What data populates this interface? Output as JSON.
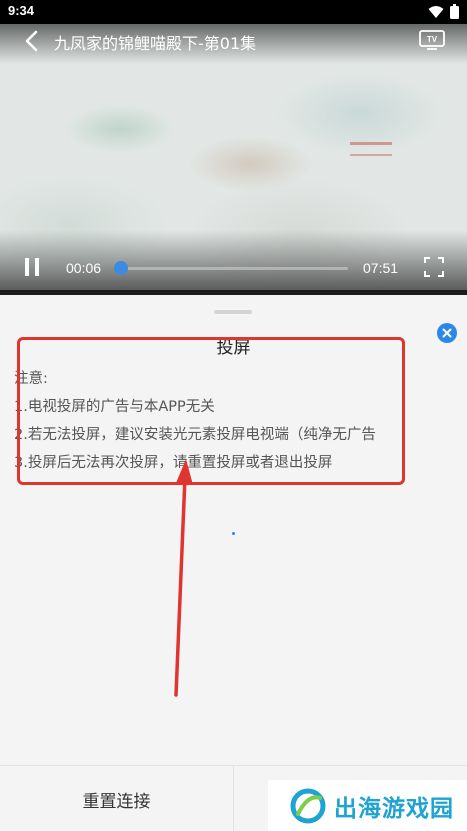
{
  "status_bar": {
    "time": "9:34"
  },
  "player": {
    "title": "九凤家的锦鲤喵殿下-第01集",
    "time_current": "00:06",
    "time_total": "07:51",
    "progress_fraction": 0.013
  },
  "cast_sheet": {
    "title": "投屏",
    "notes": [
      "注意:",
      "1.电视投屏的广告与本APP无关",
      "2.若无法投屏，建议安装光元素投屏电视端（纯净无广告",
      "3.投屏后无法再次投屏，请重置投屏或者退出投屏"
    ],
    "reset_label": "重置连接"
  },
  "watermark": {
    "text": "出海游戏园"
  },
  "colors": {
    "accent": "#2b88e8",
    "annotation_red": "#e0342e"
  }
}
